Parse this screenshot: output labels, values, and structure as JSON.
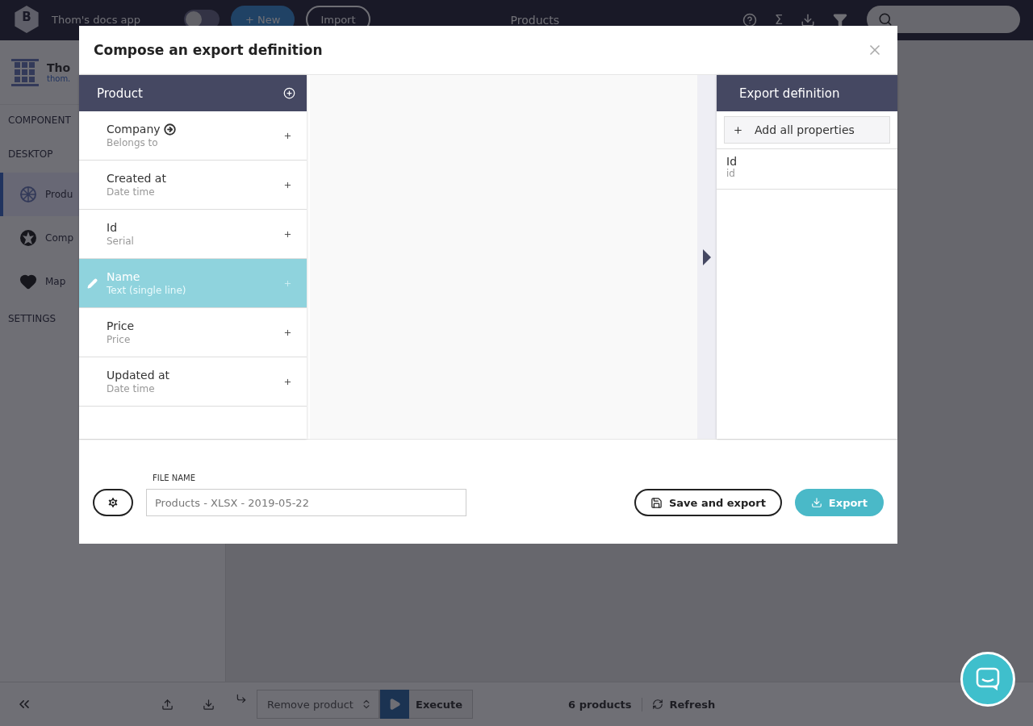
{
  "top_bar": {
    "logo_letter": "B",
    "app_name": "Thom's docs app",
    "toggle_on": false,
    "new_button": "+ New",
    "import_button": "Import",
    "title": "Products",
    "sum_symbol": "Σ"
  },
  "sidebar": {
    "profile_name": "Tho",
    "profile_email": "thom.",
    "sections": [
      {
        "label": "COMPONENT"
      },
      {
        "label": "DESKTOP",
        "items": [
          {
            "label": "Produ",
            "kind": "wheel",
            "selected": true
          },
          {
            "label": "Comp",
            "kind": "emblem",
            "selected": false
          },
          {
            "label": "Map",
            "kind": "heart",
            "selected": false
          }
        ]
      },
      {
        "label": "SETTINGS"
      }
    ]
  },
  "bottom_bar": {
    "action_select": "Remove product",
    "execute_button": "Execute",
    "count": "6 products",
    "refresh_button": "Refresh"
  },
  "modal": {
    "title": "Compose an export definition",
    "source": {
      "title": "Product",
      "fields": [
        {
          "name": "Company",
          "type": "Belongs to",
          "link": true,
          "selected": false
        },
        {
          "name": "Created at",
          "type": "Date time",
          "link": false,
          "selected": false
        },
        {
          "name": "Id",
          "type": "Serial",
          "link": false,
          "selected": false
        },
        {
          "name": "Name",
          "type": "Text (single line)",
          "link": false,
          "selected": true
        },
        {
          "name": "Price",
          "type": "Price",
          "link": false,
          "selected": false
        },
        {
          "name": "Updated at",
          "type": "Date time",
          "link": false,
          "selected": false
        }
      ]
    },
    "target": {
      "title": "Export definition",
      "add_all_button": "Add all properties",
      "fields": [
        {
          "name": "Id",
          "key": "id"
        }
      ]
    },
    "file_name": {
      "label": "FILE NAME",
      "value": "Products - XLSX - 2019-05-22"
    },
    "save_button": "Save and export",
    "export_button": "Export"
  }
}
